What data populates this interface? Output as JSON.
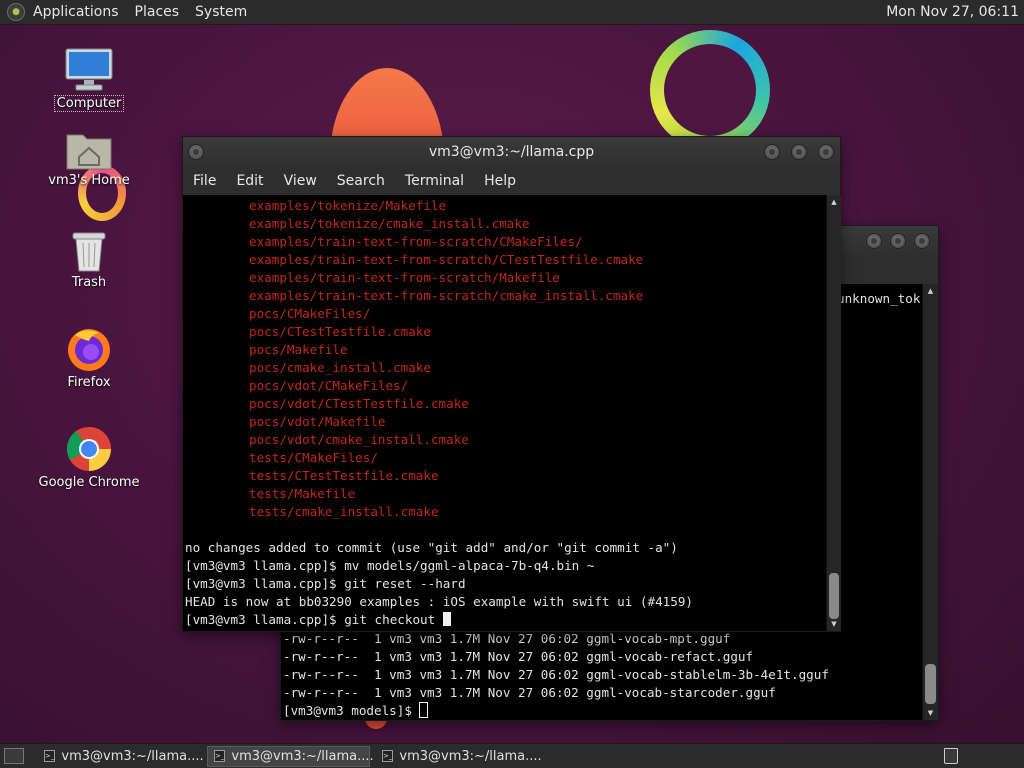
{
  "top_panel": {
    "menus": [
      "Applications",
      "Places",
      "System"
    ],
    "clock": "Mon Nov 27, 06:11"
  },
  "desktop_icons": [
    {
      "label": "Computer",
      "icon": "computer-icon"
    },
    {
      "label": "vm3's Home",
      "icon": "home-folder-icon"
    },
    {
      "label": "Trash",
      "icon": "trash-icon"
    },
    {
      "label": "Firefox",
      "icon": "firefox-icon"
    },
    {
      "label": "Google Chrome",
      "icon": "chrome-icon"
    }
  ],
  "front_terminal": {
    "title": "vm3@vm3:~/llama.cpp",
    "menu": [
      "File",
      "Edit",
      "View",
      "Search",
      "Terminal",
      "Help"
    ],
    "red_lines": [
      "examples/tokenize/Makefile",
      "examples/tokenize/cmake_install.cmake",
      "examples/train-text-from-scratch/CMakeFiles/",
      "examples/train-text-from-scratch/CTestTestfile.cmake",
      "examples/train-text-from-scratch/Makefile",
      "examples/train-text-from-scratch/cmake_install.cmake",
      "pocs/CMakeFiles/",
      "pocs/CTestTestfile.cmake",
      "pocs/Makefile",
      "pocs/cmake_install.cmake",
      "pocs/vdot/CMakeFiles/",
      "pocs/vdot/CTestTestfile.cmake",
      "pocs/vdot/Makefile",
      "pocs/vdot/cmake_install.cmake",
      "tests/CMakeFiles/",
      "tests/CTestTestfile.cmake",
      "tests/Makefile",
      "tests/cmake_install.cmake"
    ],
    "white_lines": [
      "no changes added to commit (use \"git add\" and/or \"git commit -a\")",
      "[vm3@vm3 llama.cpp]$ mv models/ggml-alpaca-7b-q4.bin ~",
      "[vm3@vm3 llama.cpp]$ git reset --hard",
      "HEAD is now at bb03290 examples : iOS example with swift ui (#4159)"
    ],
    "prompt": "[vm3@vm3 llama.cpp]$ git checkout "
  },
  "back_terminal": {
    "partial_text": "unknown_tok",
    "lines": [
      "-rw-r--r--  1 vm3 vm3 1.7M Nov 27 06:02 ggml-vocab-mpt.gguf",
      "-rw-r--r--  1 vm3 vm3 1.7M Nov 27 06:02 ggml-vocab-refact.gguf",
      "-rw-r--r--  1 vm3 vm3 1.7M Nov 27 06:02 ggml-vocab-stablelm-3b-4e1t.gguf",
      "-rw-r--r--  1 vm3 vm3 1.7M Nov 27 06:02 ggml-vocab-starcoder.gguf"
    ],
    "prompt": "[vm3@vm3 models]$ "
  },
  "taskbar": {
    "tasks": [
      {
        "label": "vm3@vm3:~/llama....",
        "active": false
      },
      {
        "label": "vm3@vm3:~/llama....",
        "active": true
      },
      {
        "label": "vm3@vm3:~/llama....",
        "active": false
      }
    ]
  }
}
